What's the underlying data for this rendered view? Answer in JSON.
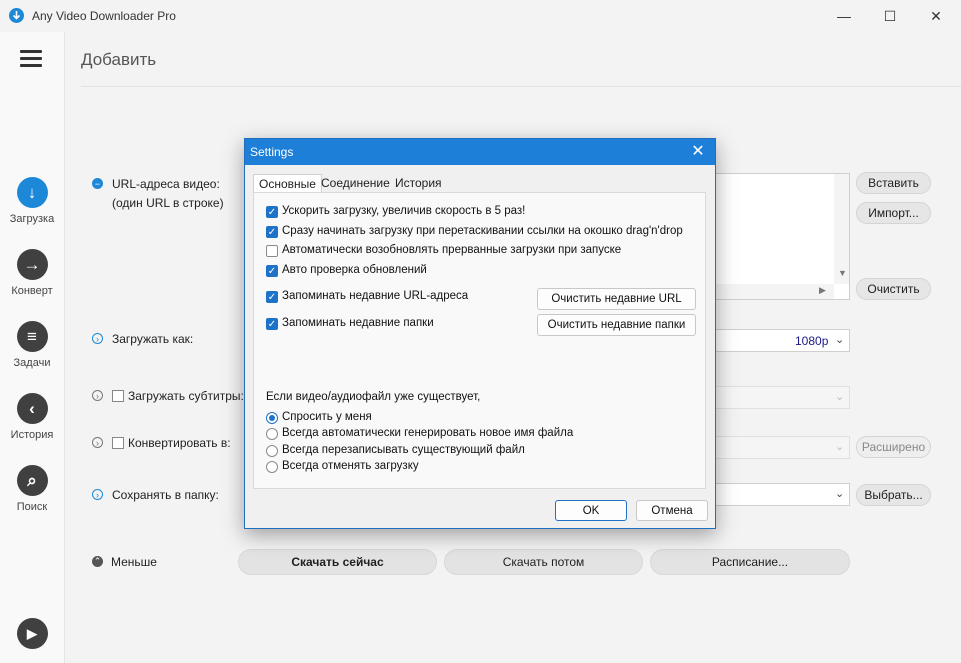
{
  "app": {
    "title": "Any Video Downloader Pro"
  },
  "window_controls": {
    "minimize": "—",
    "maximize": "☐",
    "close": "✕"
  },
  "sidebar": {
    "items": [
      {
        "label": "Загрузка",
        "icon": "download-icon",
        "glyph": "↓"
      },
      {
        "label": "Конверт",
        "icon": "convert-icon",
        "glyph": "→"
      },
      {
        "label": "Задачи",
        "icon": "tasks-icon",
        "glyph": "≡"
      },
      {
        "label": "История",
        "icon": "history-icon",
        "glyph": "‹"
      },
      {
        "label": "Поиск",
        "icon": "search-icon",
        "glyph": "⌕"
      }
    ],
    "play_glyph": "▶"
  },
  "main": {
    "title": "Добавить",
    "url_label_1": "URL-адреса видео:",
    "url_label_2": "(один URL в строке)",
    "paste_button": "Вставить",
    "import_button": "Импорт...",
    "clear_button": "Очистить",
    "download_as_label": "Загружать как:",
    "quality_value": "1080p",
    "subtitles_label": "Загружать субтитры:",
    "convert_to_label": "Конвертировать в:",
    "advanced_button": "Расширено",
    "save_to_label": "Сохранять в папку:",
    "choose_button": "Выбрать...",
    "less_label": "Меньше",
    "download_now": "Скачать сейчас",
    "download_later": "Скачать потом",
    "schedule": "Расписание..."
  },
  "dialog": {
    "title": "Settings",
    "close_glyph": "✕",
    "tabs": [
      "Основные",
      "Соединение",
      "История"
    ],
    "checkboxes": [
      {
        "label": "Ускорить загрузку, увеличив скорость в 5 раз!",
        "checked": true
      },
      {
        "label": "Сразу начинать загрузку при перетаскивании ссылки на окошко drag'n'drop",
        "checked": true
      },
      {
        "label": "Автоматически возобновлять прерванные загрузки при запуске",
        "checked": false
      },
      {
        "label": "Авто проверка обновлений",
        "checked": true
      },
      {
        "label": "Запоминать недавние URL-адреса",
        "checked": true
      },
      {
        "label": "Запоминать недавние папки",
        "checked": true
      }
    ],
    "clear_recent_urls": "Очистить недавние URL",
    "clear_recent_folders": "Очистить недавние папки",
    "exists_heading": "Если видео/аудиофайл уже существует,",
    "radios": [
      {
        "label": "Спросить у меня",
        "selected": true
      },
      {
        "label": "Всегда автоматически генерировать новое имя файла",
        "selected": false
      },
      {
        "label": "Всегда перезаписывать существующий файл",
        "selected": false
      },
      {
        "label": "Всегда отменять загрузку",
        "selected": false
      }
    ],
    "ok": "OK",
    "cancel": "Отмена"
  },
  "colors": {
    "accent": "#1e7fd8",
    "sidebar_icon": "#404040"
  }
}
